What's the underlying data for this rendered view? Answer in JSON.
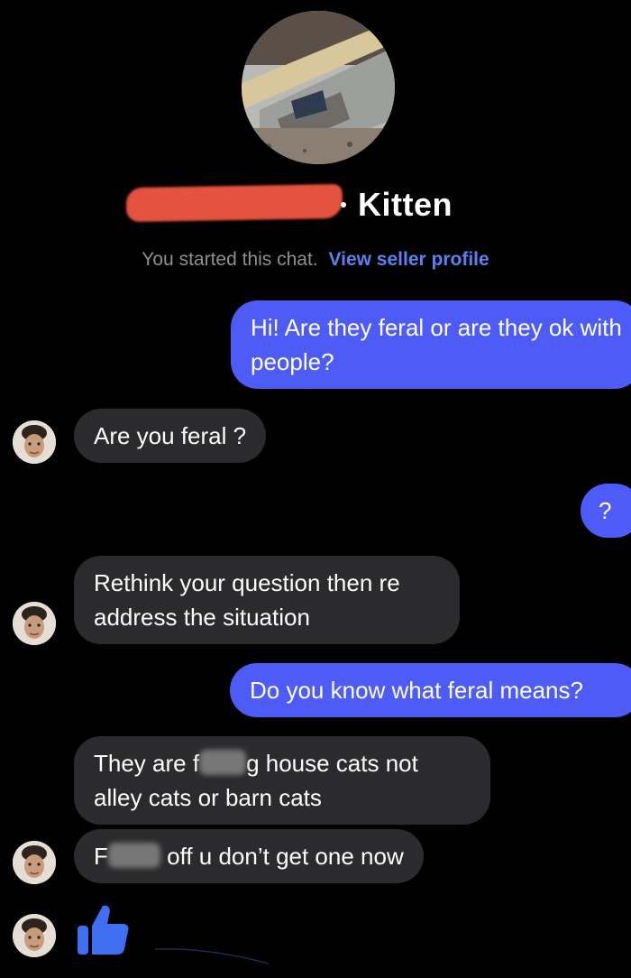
{
  "header": {
    "title": "Kitten",
    "started_text": "You started this chat.",
    "seller_link": "View seller profile"
  },
  "messages": [
    {
      "from": "me",
      "text": "Hi! Are they feral or are they ok with people?"
    },
    {
      "from": "seller",
      "text": "Are you feral ?"
    },
    {
      "from": "me",
      "text": "?"
    },
    {
      "from": "seller",
      "text": "Rethink your question then re address the situation"
    },
    {
      "from": "me",
      "text": "Do you know what feral means?"
    },
    {
      "from": "seller",
      "text_before": "They are f",
      "text_after": "g house cats not alley cats or barn cats"
    },
    {
      "from": "seller",
      "text_before": "F",
      "text_after": " off u don’t get one now"
    }
  ],
  "reaction": {
    "icon": "thumbs-up-icon"
  },
  "colors": {
    "sent_bubble": "#4d5cf6",
    "received_bubble": "#2b2b2d",
    "link": "#5b82f0",
    "background": "#000000",
    "redaction": "#e5523f"
  }
}
